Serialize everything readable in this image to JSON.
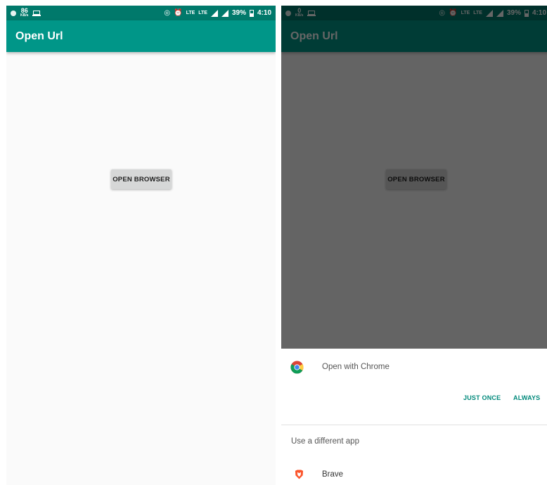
{
  "colors": {
    "toolbar": "#009688",
    "statusbar": "#00796b",
    "accent": "#00897b",
    "background": "#fafafa",
    "button": "#d6d7d7"
  },
  "left_screen": {
    "statusbar": {
      "speed_value": "86",
      "speed_unit": "KB/s",
      "lte1": "LTE",
      "lte2": "LTE",
      "battery": "39%",
      "time": "4:10"
    },
    "toolbar": {
      "title": "Open Url"
    },
    "button": {
      "label": "OPEN BROWSER"
    }
  },
  "right_screen": {
    "statusbar": {
      "speed_value": "0",
      "speed_unit": "KB/s",
      "lte1": "LTE",
      "lte2": "LTE",
      "battery": "39%",
      "time": "4:10"
    },
    "toolbar": {
      "title": "Open Url"
    },
    "button": {
      "label": "OPEN BROWSER"
    },
    "chooser": {
      "default_app": {
        "label": "Open with Chrome",
        "icon": "chrome-icon"
      },
      "just_once": "JUST ONCE",
      "always": "ALWAYS",
      "other_heading": "Use a different app",
      "apps": [
        {
          "name": "Brave",
          "icon": "brave-icon"
        }
      ]
    }
  }
}
